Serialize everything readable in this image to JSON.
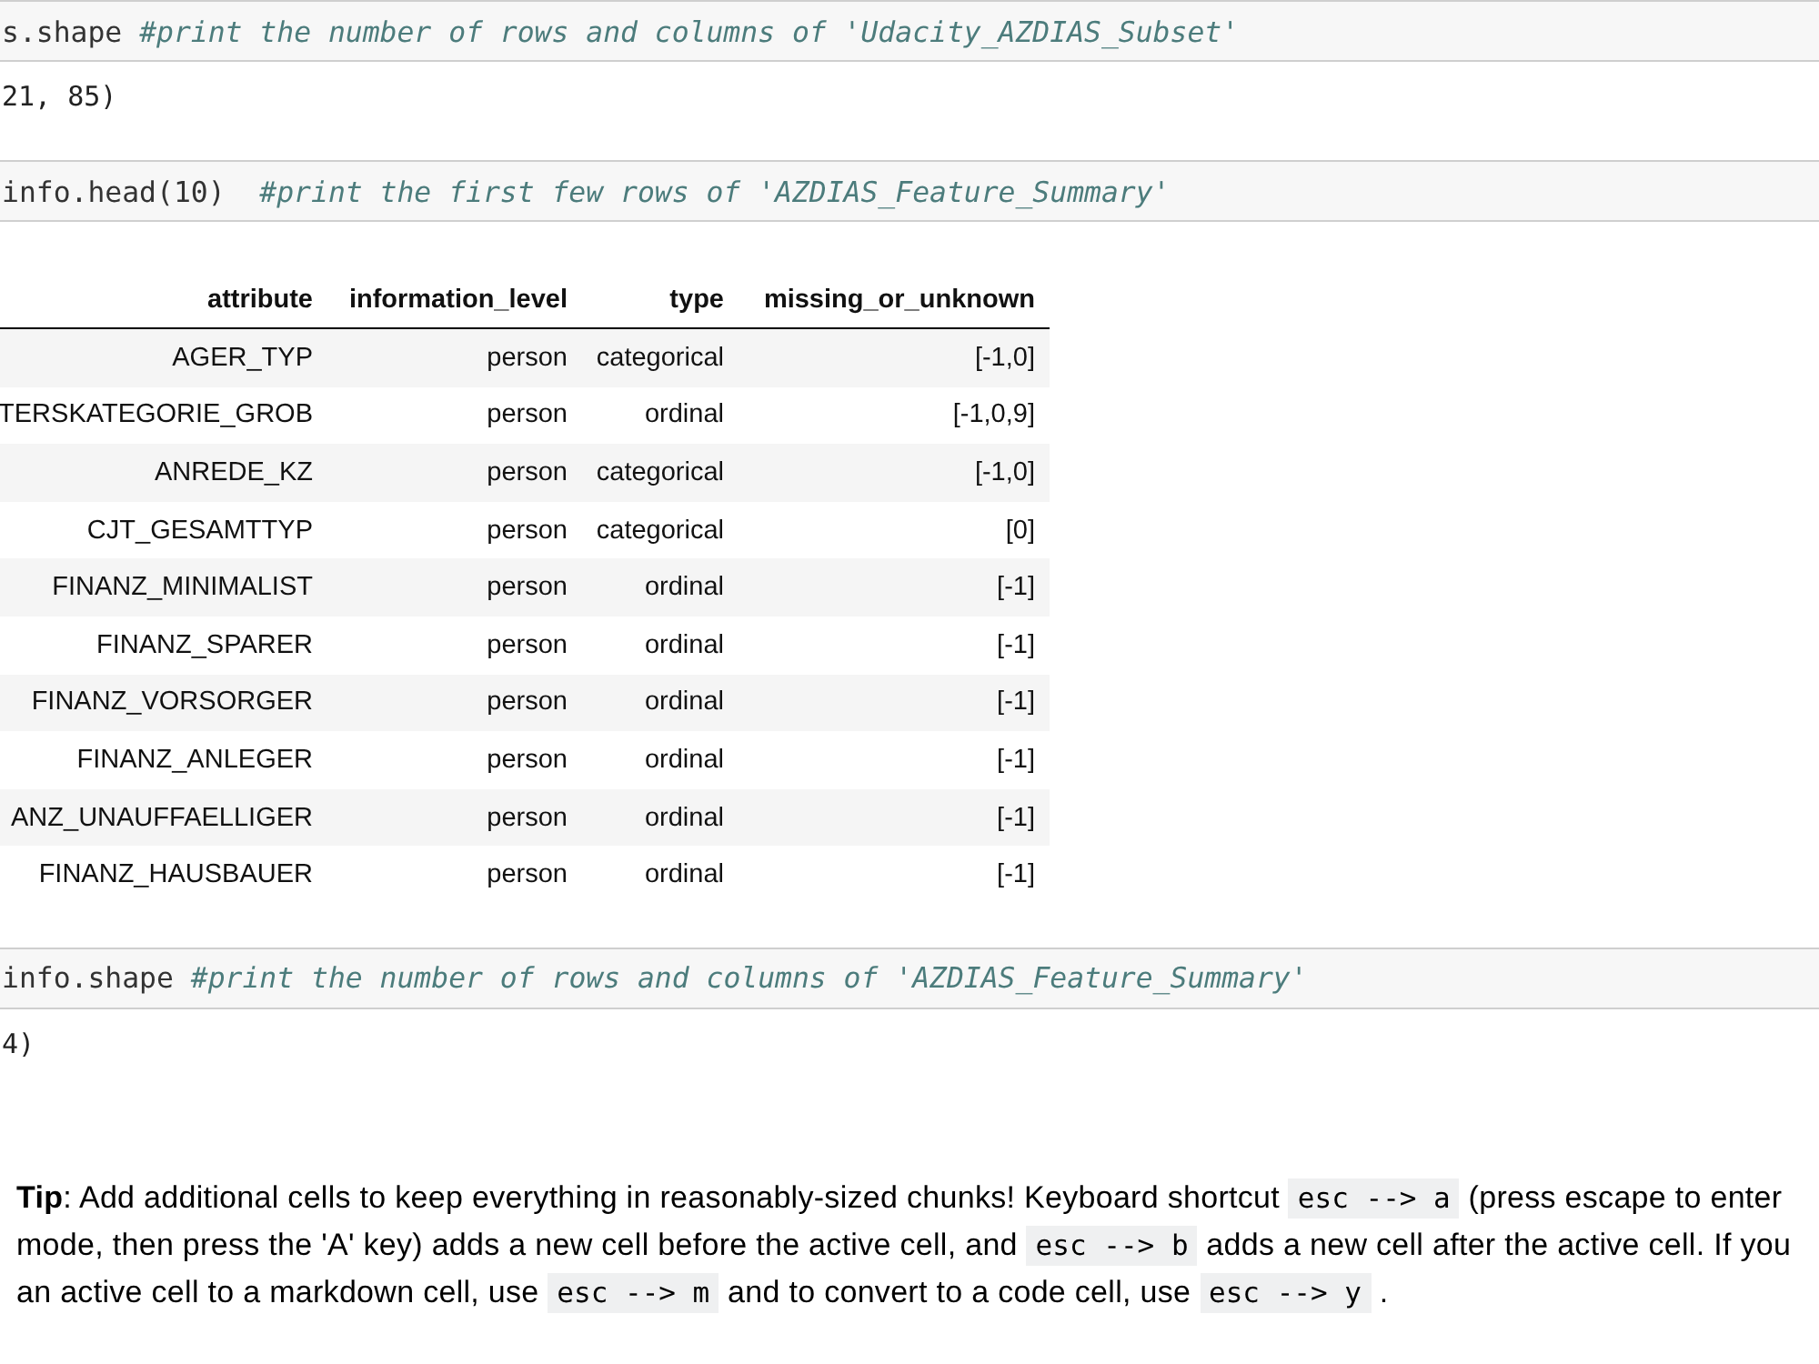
{
  "cells": [
    {
      "kind": "code",
      "source": "s.shape *#print the number of rows and columns of 'Udacity_AZDIAS_Subset'*",
      "output": {
        "kind": "text",
        "text": "21, 85)"
      }
    },
    {
      "kind": "code",
      "source": "info.head(10)  *#print the first few rows of 'AZDIAS_Feature_Summary'*",
      "output": {
        "kind": "table",
        "columns": [
          "attribute",
          "information_level",
          "type",
          "missing_or_unknown"
        ],
        "rows": [
          [
            "AGER_TYP",
            "person",
            "categorical",
            "[-1,0]"
          ],
          [
            "TERSKATEGORIE_GROB",
            "person",
            "ordinal",
            "[-1,0,9]"
          ],
          [
            "ANREDE_KZ",
            "person",
            "categorical",
            "[-1,0]"
          ],
          [
            "CJT_GESAMTTYP",
            "person",
            "categorical",
            "[0]"
          ],
          [
            "FINANZ_MINIMALIST",
            "person",
            "ordinal",
            "[-1]"
          ],
          [
            "FINANZ_SPARER",
            "person",
            "ordinal",
            "[-1]"
          ],
          [
            "FINANZ_VORSORGER",
            "person",
            "ordinal",
            "[-1]"
          ],
          [
            "FINANZ_ANLEGER",
            "person",
            "ordinal",
            "[-1]"
          ],
          [
            "ANZ_UNAUFFAELLIGER",
            "person",
            "ordinal",
            "[-1]"
          ],
          [
            "FINANZ_HAUSBAUER",
            "person",
            "ordinal",
            "[-1]"
          ]
        ]
      }
    },
    {
      "kind": "code",
      "source": "info.shape *#print the number of rows and columns of 'AZDIAS_Feature_Summary'*",
      "output": {
        "kind": "text",
        "text": "4)"
      }
    },
    {
      "kind": "markdown",
      "lines": [
        [
          {
            "kind": "text",
            "text": "**Tip**: Add additional cells to keep everything in reasonably-sized chunks! Keyboard shortcut"
          },
          {
            "kind": "code",
            "text": "esc --> a"
          },
          {
            "kind": "text",
            "text": "(press escape to enter"
          }
        ],
        [
          {
            "kind": "text",
            "text": "mode, then press the 'A' key) adds a new cell before the active cell, and"
          },
          {
            "kind": "code",
            "text": "esc --> b"
          },
          {
            "kind": "text",
            "text": "adds a new cell after the active cell. If you"
          }
        ],
        [
          {
            "kind": "text",
            "text": "an active cell to a markdown cell, use"
          },
          {
            "kind": "code",
            "text": "esc --> m"
          },
          {
            "kind": "text",
            "text": "and to convert to a code cell, use"
          },
          {
            "kind": "code",
            "text": "esc --> y"
          },
          {
            "kind": "text",
            "text": "."
          }
        ]
      ]
    }
  ]
}
